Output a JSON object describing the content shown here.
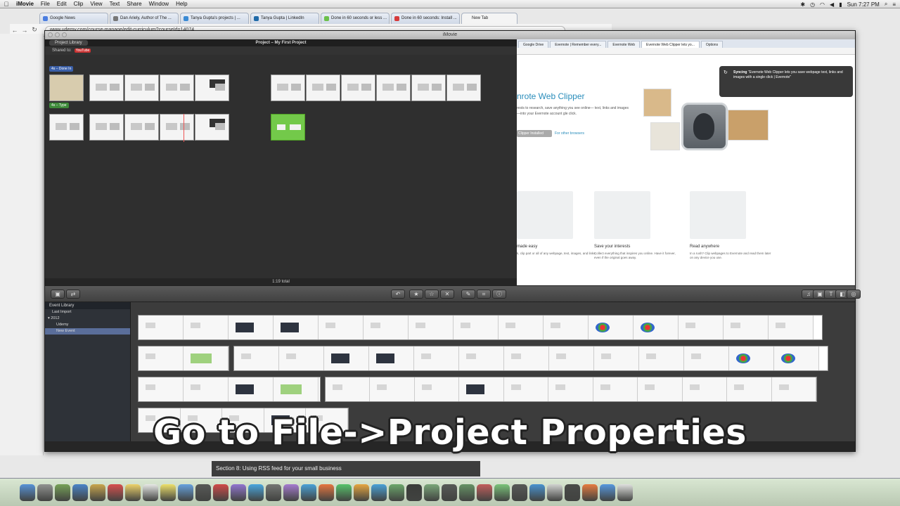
{
  "menubar": {
    "app": "iMovie",
    "items": [
      "File",
      "Edit",
      "Clip",
      "View",
      "Text",
      "Share",
      "Window",
      "Help"
    ],
    "clock": "Sun 7:27 PM"
  },
  "browser": {
    "tabs": [
      {
        "label": "Google News",
        "color": "#4a7de0"
      },
      {
        "label": "Dan Ariely, Author of The ...",
        "color": "#777777"
      },
      {
        "label": "Tanya Gupta's projects | ...",
        "color": "#3a8ad4"
      },
      {
        "label": "Tanya Gupta | LinkedIn",
        "color": "#1f6aa8"
      },
      {
        "label": "Done in 60 seconds or less ...",
        "color": "#6cc04a"
      },
      {
        "label": "Done in 60 seconds: Install ...",
        "color": "#d63a3a"
      },
      {
        "label": "New Tab",
        "color": "#cccccc"
      }
    ],
    "url": "www.udemy.com/course-manage/edit-curriculum?courseId=14074"
  },
  "imovie": {
    "window_title": "iMovie",
    "project_library_btn": "Project Library",
    "project_title": "Project – My First Project",
    "shared_to_label": "Shared to:",
    "shared_badge": "YouTube",
    "title_tag_1": "4s – Done In",
    "title_tag_2": "4s – Type",
    "total_time": "1:19 total",
    "event_library_label": "Event Library",
    "events": [
      {
        "label": "Last Import",
        "selected": false
      },
      {
        "label": "2012",
        "selected": false
      },
      {
        "label": "Udemy",
        "selected": false
      },
      {
        "label": "New Event",
        "selected": true
      }
    ]
  },
  "viewer": {
    "tabs": [
      "Google Drive",
      "Evernote | Remember every...",
      "Evernote Web",
      "Evernote Web Clipper lets yo...",
      "Options"
    ],
    "title": "nrote Web Clipper",
    "intro": "rests to research, save anything you see online— text, links and images—into your Evernote account gle click.",
    "install_btn": "Clipper Installed",
    "other_link": "For other browsers",
    "sync_title": "Syncing",
    "sync_text": "\"Evernote Web Clipper lets you save webpage text, links and images with a single click | Evernote\"",
    "cards": [
      {
        "title": "made easy",
        "text": "k, clip part or all of any webpage, text, images, and links."
      },
      {
        "title": "Save your interests",
        "text": "Collect everything that inspires you online. Have it forever, even if the original goes away."
      },
      {
        "title": "Read anywhere",
        "text": "In a rush? Clip webpages to Evernote and read them later on any device you use."
      }
    ]
  },
  "caption": "Go to File->Project Properties",
  "section_bar": "Section 8: Using RSS feed for your small business",
  "dock_colors": [
    "#4a8ad8",
    "#8a8a8a",
    "#6c9a4a",
    "#3a7ac8",
    "#c8a040",
    "#d84040",
    "#f0d060",
    "#e8e8e8",
    "#f0e060",
    "#5a9ae0",
    "#4a4a4a",
    "#d03a3a",
    "#8a6ad0",
    "#3aa0e0",
    "#6a6a6a",
    "#a070d0",
    "#3a9ad8",
    "#e86a30",
    "#4ac060",
    "#e8a030",
    "#3a9ad8",
    "#60a060",
    "#2a2a2a",
    "#70a070",
    "#4a4a4a",
    "#5a8a5a",
    "#c05050",
    "#70c070",
    "#4a4a4a",
    "#3a8ad0",
    "#d0d0d0",
    "#3a3a3a",
    "#e87030",
    "#4a90e0",
    "#e0e0e0"
  ]
}
